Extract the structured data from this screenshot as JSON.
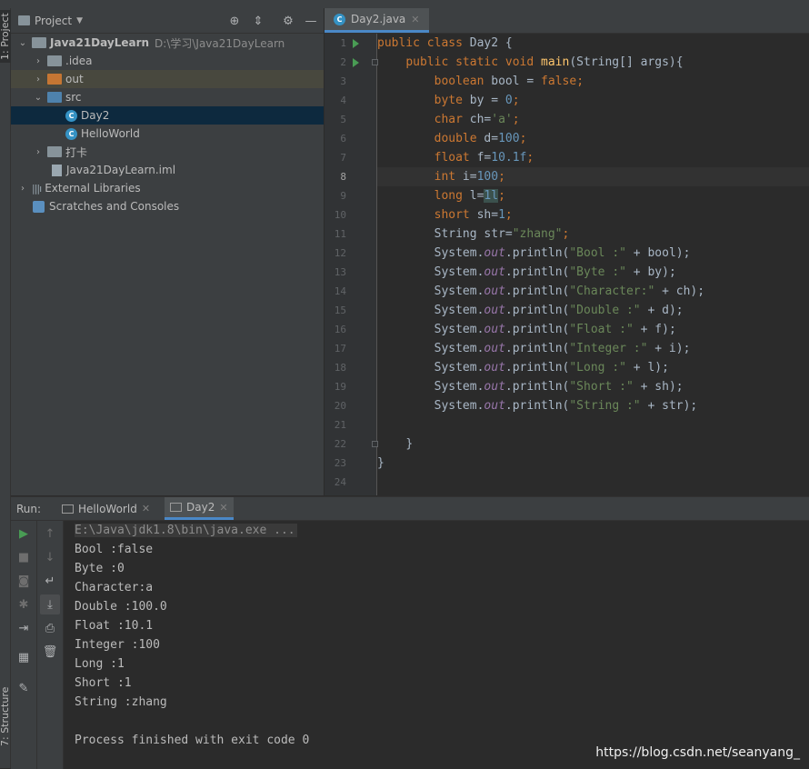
{
  "tool_windows": {
    "project_tab": "1: Project",
    "structure_tab": "7: Structure"
  },
  "project": {
    "header_title": "Project",
    "tree": [
      {
        "label": "Java21DayLearn",
        "path": "D:\\学习\\Java21DayLearn",
        "icon": "module-folder-icon"
      },
      {
        "label": ".idea",
        "icon": "folder-icon"
      },
      {
        "label": "out",
        "icon": "excluded-folder-icon"
      },
      {
        "label": "src",
        "icon": "source-folder-icon"
      },
      {
        "label": "Day2",
        "icon": "java-class-icon"
      },
      {
        "label": "HelloWorld",
        "icon": "java-class-icon"
      },
      {
        "label": "打卡",
        "icon": "folder-icon"
      },
      {
        "label": "Java21DayLearn.iml",
        "icon": "iml-file-icon"
      },
      {
        "label": "External Libraries",
        "icon": "libraries-icon"
      },
      {
        "label": "Scratches and Consoles",
        "icon": "scratches-icon"
      }
    ]
  },
  "editor": {
    "active_tab": "Day2.java",
    "current_line": 8,
    "line_numbers": [
      "1",
      "2",
      "3",
      "4",
      "5",
      "6",
      "7",
      "8",
      "9",
      "10",
      "11",
      "12",
      "13",
      "14",
      "15",
      "16",
      "17",
      "18",
      "19",
      "20",
      "21",
      "22",
      "23",
      "24"
    ]
  },
  "code": {
    "l1": {
      "kw": "public class",
      "rest": " Day2 {"
    },
    "l2": {
      "kw": "public static void",
      "fn": "main",
      "rest": "(String[] args){"
    },
    "l3": {
      "kw": "boolean",
      "mid": " bool = ",
      "val": "false",
      "end": ";"
    },
    "l4": {
      "kw": "byte",
      "mid": " by = ",
      "val": "0",
      "end": ";"
    },
    "l5": {
      "kw": "char",
      "mid": " ch=",
      "val": "'a'",
      "end": ";"
    },
    "l6": {
      "kw": "double",
      "mid": " d=",
      "val": "100",
      "end": ";"
    },
    "l7": {
      "kw": "float",
      "mid": " f=",
      "val": "10.1f",
      "end": ";"
    },
    "l8": {
      "kw": "int",
      "mid": " i=",
      "val": "100",
      "end": ";"
    },
    "l9": {
      "kw": "long",
      "mid": " l=",
      "val": "1l",
      "end": ";"
    },
    "l10": {
      "kw": "short",
      "mid": " sh=",
      "val": "1",
      "end": ";"
    },
    "l11": {
      "pre": "String str=",
      "val": "\"zhang\"",
      "end": ";"
    },
    "println": [
      {
        "str": "\"Bool :\"",
        "var": " + bool);"
      },
      {
        "str": "\"Byte :\"",
        "var": " + by);"
      },
      {
        "str": "\"Character:\"",
        "var": " + ch);"
      },
      {
        "str": "\"Double :\"",
        "var": " + d);"
      },
      {
        "str": "\"Float :\"",
        "var": " + f);"
      },
      {
        "str": "\"Integer :\"",
        "var": " + i);"
      },
      {
        "str": "\"Long :\"",
        "var": " + l);"
      },
      {
        "str": "\"Short :\"",
        "var": " + sh);"
      },
      {
        "str": "\"String :\"",
        "var": " + str);"
      }
    ],
    "system": "System.",
    "out": "out",
    "println_call": ".println(",
    "close_method": "}",
    "close_class": "}"
  },
  "run": {
    "label": "Run:",
    "tabs": [
      "HelloWorld",
      "Day2"
    ],
    "active_tab": "Day2",
    "command": "E:\\Java\\jdk1.8\\bin\\java.exe ...",
    "output": [
      "Bool :false",
      "Byte :0",
      "Character:a",
      "Double :100.0",
      "Float :10.1",
      "Integer :100",
      "Long :1",
      "Short :1",
      "String :zhang",
      "",
      "Process finished with exit code 0"
    ]
  },
  "watermark": "https://blog.csdn.net/seanyang_",
  "colors": {
    "keyword": "#cc7832",
    "number": "#6897bb",
    "string": "#6a8759",
    "method": "#ffc66d",
    "static_field": "#9876aa",
    "accent": "#4a88c7"
  }
}
